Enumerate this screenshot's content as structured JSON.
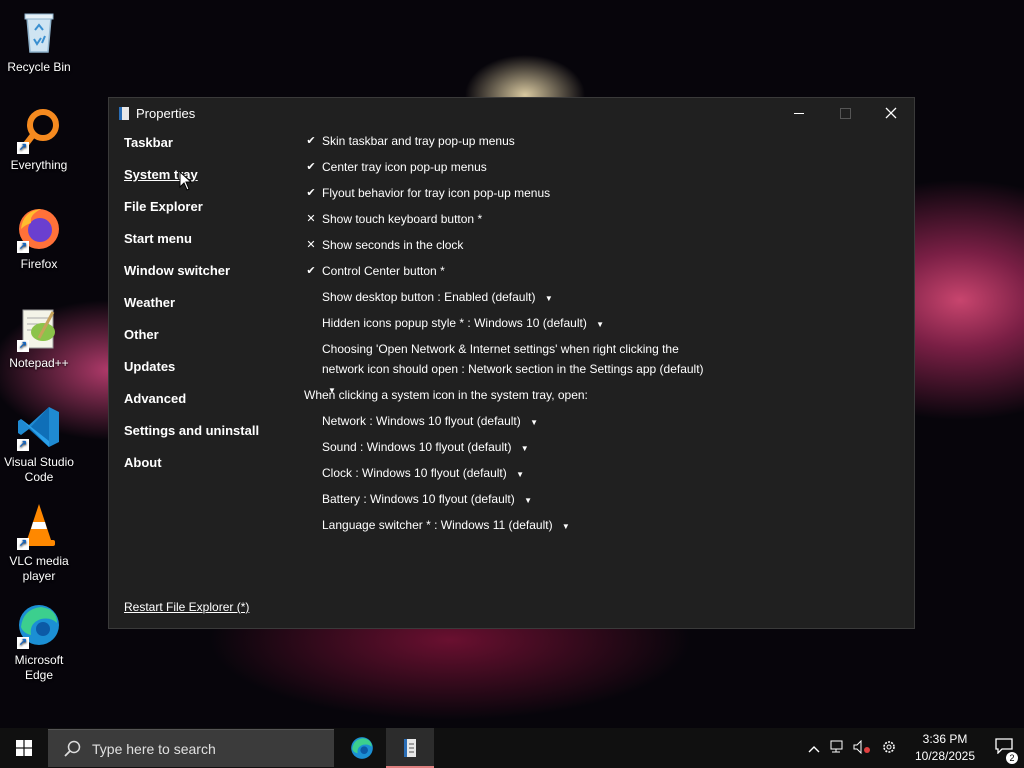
{
  "desktop": {
    "icons": [
      {
        "label": "Recycle Bin"
      },
      {
        "label": "Everything"
      },
      {
        "label": "Firefox"
      },
      {
        "label": "Notepad++"
      },
      {
        "label": "Visual Studio Code"
      },
      {
        "label": "VLC media player"
      },
      {
        "label": "Microsoft Edge"
      }
    ]
  },
  "window": {
    "title": "Properties",
    "nav": {
      "items": [
        {
          "label": "Taskbar"
        },
        {
          "label": "System tray"
        },
        {
          "label": "File Explorer"
        },
        {
          "label": "Start menu"
        },
        {
          "label": "Window switcher"
        },
        {
          "label": "Weather"
        },
        {
          "label": "Other"
        },
        {
          "label": "Updates"
        },
        {
          "label": "Advanced"
        },
        {
          "label": "Settings and uninstall"
        },
        {
          "label": "About"
        }
      ],
      "selected": "System tray"
    },
    "restart_link": "Restart File Explorer (*)",
    "settings": [
      {
        "label": "Skin taskbar and tray pop-up menus",
        "state": "checked"
      },
      {
        "label": "Center tray icon pop-up menus",
        "state": "checked"
      },
      {
        "label": "Flyout behavior for tray icon pop-up menus",
        "state": "checked"
      },
      {
        "label": "Show touch keyboard button *",
        "state": "unchecked"
      },
      {
        "label": "Show seconds in the clock",
        "state": "unchecked"
      },
      {
        "label": "Control Center button *",
        "state": "checked"
      },
      {
        "label": "Show desktop button : Enabled (default)",
        "state": "dropdown"
      },
      {
        "label": "Hidden icons popup style * : Windows 10 (default)",
        "state": "dropdown"
      },
      {
        "label": "Choosing 'Open Network & Internet settings' when right clicking the network icon should open : Network section in the Settings app (default)",
        "state": "dropdown"
      },
      {
        "label": "When clicking a system icon in the system tray, open:",
        "state": "heading"
      },
      {
        "label": "Network : Windows 10 flyout (default)",
        "state": "dropdown"
      },
      {
        "label": "Sound : Windows 10 flyout (default)",
        "state": "dropdown"
      },
      {
        "label": "Clock : Windows 10 flyout (default)",
        "state": "dropdown"
      },
      {
        "label": "Battery : Windows 10 flyout (default)",
        "state": "dropdown"
      },
      {
        "label": "Language switcher * : Windows 11 (default)",
        "state": "dropdown"
      }
    ],
    "check_glyph": "✔",
    "cross_glyph": "✕",
    "caret_glyph": "▼"
  },
  "taskbar": {
    "search_placeholder": "Type here to search",
    "time": "3:36 PM",
    "date": "10/28/2025",
    "notification_count": "2"
  },
  "colors": {
    "window_bg": "#202020",
    "taskbar_bg": "#101010",
    "accent_underline": "#e08080"
  }
}
